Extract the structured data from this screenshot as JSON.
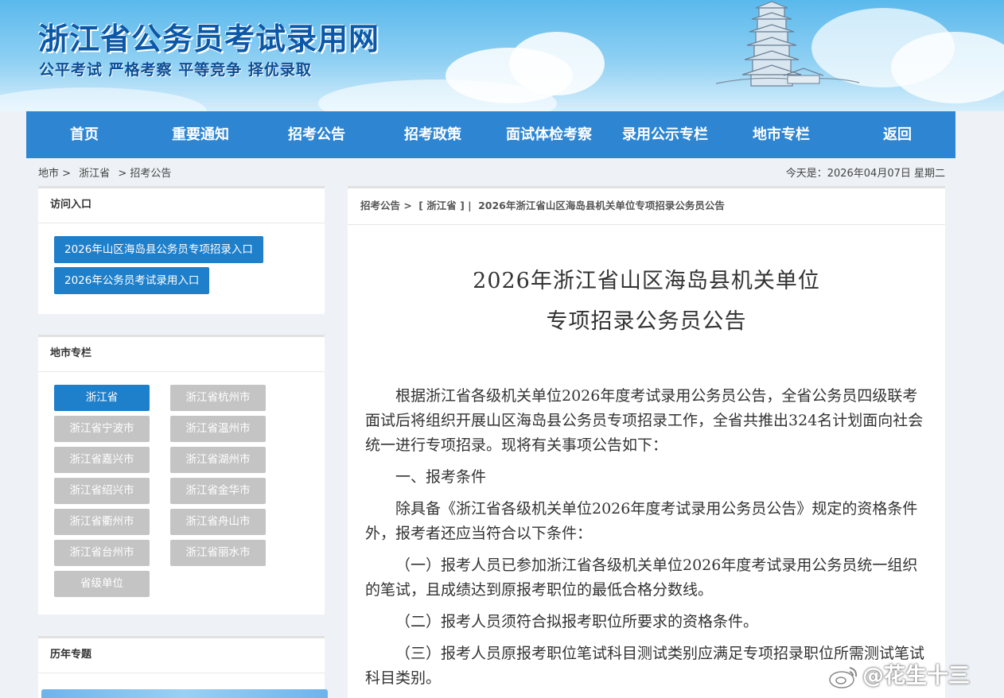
{
  "header": {
    "site_title": "浙江省公务员考试录用网",
    "slogan": "公平考试 严格考察 平等竞争 择优录取"
  },
  "nav": {
    "items": [
      "首页",
      "重要通知",
      "招考公告",
      "招考政策",
      "面试体检考察",
      "录用公示专栏",
      "地市专栏",
      "返回"
    ]
  },
  "breadcrumb": {
    "items": [
      "地市 >",
      "浙江省",
      "> 招考公告"
    ],
    "today": "今天是：2026年04月07日 星期二"
  },
  "sidebar": {
    "access": {
      "title": "访问入口",
      "buttons": [
        "2026年山区海岛县公务员专项招录入口",
        "2026年公务员考试录用入口"
      ]
    },
    "cities": {
      "title": "地市专栏",
      "items": [
        "浙江省",
        "浙江省杭州市",
        "浙江省宁波市",
        "浙江省温州市",
        "浙江省嘉兴市",
        "浙江省湖州市",
        "浙江省绍兴市",
        "浙江省金华市",
        "浙江省衢州市",
        "浙江省舟山市",
        "浙江省台州市",
        "浙江省丽水市",
        "省级单位"
      ],
      "active": "浙江省"
    },
    "history": {
      "title": "历年专题"
    }
  },
  "article": {
    "crumb": [
      "招考公告 >",
      "[ 浙江省 ] |",
      "2026年浙江省山区海岛县机关单位专项招录公务员公告"
    ],
    "title_line1": "2026年浙江省山区海岛县机关单位",
    "title_line2": "专项招录公务员公告",
    "paragraphs": [
      "根据浙江省各级机关单位2026年度考试录用公务员公告，全省公务员四级联考面试后将组织开展山区海岛县公务员专项招录工作，全省共推出324名计划面向社会统一进行专项招录。现将有关事项公告如下：",
      "一、报考条件",
      "除具备《浙江省各级机关单位2026年度考试录用公务员公告》规定的资格条件外，报考者还应当符合以下条件：",
      "（一）报考人员已参加浙江省各级机关单位2026年度考试录用公务员统一组织的笔试，且成绩达到原报考职位的最低合格分数线。",
      "（二）报考人员须符合拟报考职位所要求的资格条件。",
      "（三）报考人员原报考职位笔试科目测试类别应满足专项招录职位所需测试笔试科目类别。"
    ]
  },
  "watermark": "@花生十三",
  "colors": {
    "nav_bg": "#2e86d3",
    "button_blue": "#1e7fcb",
    "button_gray": "#c4c4c4",
    "title_blue": "#0b58a8"
  }
}
